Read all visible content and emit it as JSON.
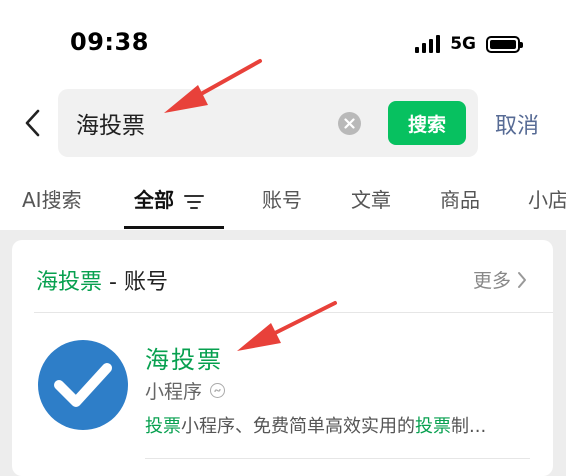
{
  "status_bar": {
    "time": "09:38",
    "network": "5G",
    "battery_level": 1.0
  },
  "search": {
    "query": "海投票",
    "button_label": "搜索",
    "cancel_label": "取消"
  },
  "tabs": [
    {
      "label": "AI搜索",
      "active": false
    },
    {
      "label": "全部",
      "active": true
    },
    {
      "label": "账号",
      "active": false
    },
    {
      "label": "文章",
      "active": false
    },
    {
      "label": "商品",
      "active": false
    },
    {
      "label": "小店",
      "active": false
    }
  ],
  "section": {
    "keyword": "海投票",
    "suffix": " - 账号",
    "more_label": "更多"
  },
  "account": {
    "name": "海投票",
    "type": "小程序",
    "desc_highlight_1": "投票",
    "desc_middle": "小程序、免费简单高效实用的",
    "desc_highlight_2": "投票",
    "desc_tail": "制..."
  },
  "colors": {
    "accent_green": "#07c160",
    "keyword_green": "#07a04f",
    "link_blue": "#576b95",
    "annotation_red": "#e8413a"
  },
  "icons": [
    "back-chevron-icon",
    "clear-icon",
    "filter-icon",
    "chevron-right-icon",
    "checkmark-icon",
    "mini-program-icon",
    "signal-icon",
    "battery-icon"
  ]
}
